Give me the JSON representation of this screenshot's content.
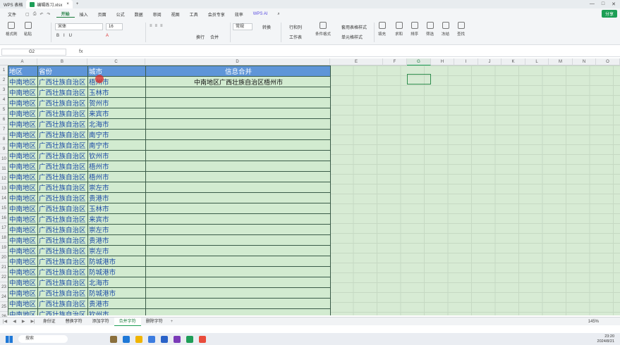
{
  "window": {
    "app_tab": "WPS 表格",
    "doc_tab": "编辑练习.xlsx"
  },
  "menu": {
    "file": "文件",
    "items": [
      "开始",
      "插入",
      "页面",
      "公式",
      "数据",
      "审阅",
      "视图",
      "工具",
      "会员专享",
      "效率"
    ],
    "ai": "WPS AI",
    "share": "分享"
  },
  "ribbon": {
    "format_painter": "格式刷",
    "paste": "粘贴",
    "font_name": "宋体",
    "font_size": "16",
    "wrap": "换行",
    "merge": "合并",
    "number_format": "常规",
    "convert": "转换",
    "row_col": "行和列",
    "worksheet": "工作表",
    "cond_format": "条件格式",
    "table_style": "套用表格样式",
    "cell_style": "单元格样式",
    "fill": "填充",
    "sum": "求和",
    "sort": "排序",
    "filter": "筛选",
    "freeze": "冻结",
    "find": "查找"
  },
  "formula_bar": {
    "cell_ref": "G2",
    "fx": "fx"
  },
  "columns": [
    "A",
    "B",
    "C",
    "D",
    "E",
    "F",
    "G",
    "H",
    "I",
    "J",
    "K",
    "L",
    "M",
    "N",
    "O"
  ],
  "sheet": {
    "headers": [
      "地区",
      "省份",
      "城市",
      "信息合并"
    ],
    "merged_value": "中南地区广西壮族自治区梧州市",
    "rows": [
      [
        "中南地区",
        "广西壮族自治区",
        "梧州市"
      ],
      [
        "中南地区",
        "广西壮族自治区",
        "玉林市"
      ],
      [
        "中南地区",
        "广西壮族自治区",
        "贺州市"
      ],
      [
        "中南地区",
        "广西壮族自治区",
        "来宾市"
      ],
      [
        "中南地区",
        "广西壮族自治区",
        "北海市"
      ],
      [
        "中南地区",
        "广西壮族自治区",
        "南宁市"
      ],
      [
        "中南地区",
        "广西壮族自治区",
        "南宁市"
      ],
      [
        "中南地区",
        "广西壮族自治区",
        "钦州市"
      ],
      [
        "中南地区",
        "广西壮族自治区",
        "梧州市"
      ],
      [
        "中南地区",
        "广西壮族自治区",
        "梧州市"
      ],
      [
        "中南地区",
        "广西壮族自治区",
        "崇左市"
      ],
      [
        "中南地区",
        "广西壮族自治区",
        "贵港市"
      ],
      [
        "中南地区",
        "广西壮族自治区",
        "玉林市"
      ],
      [
        "中南地区",
        "广西壮族自治区",
        "来宾市"
      ],
      [
        "中南地区",
        "广西壮族自治区",
        "崇左市"
      ],
      [
        "中南地区",
        "广西壮族自治区",
        "贵港市"
      ],
      [
        "中南地区",
        "广西壮族自治区",
        "崇左市"
      ],
      [
        "中南地区",
        "广西壮族自治区",
        "防城港市"
      ],
      [
        "中南地区",
        "广西壮族自治区",
        "防城港市"
      ],
      [
        "中南地区",
        "广西壮族自治区",
        "北海市"
      ],
      [
        "中南地区",
        "广西壮族自治区",
        "防城港市"
      ],
      [
        "中南地区",
        "广西壮族自治区",
        "贵港市"
      ],
      [
        "中南地区",
        "广西壮族自治区",
        "钦州市"
      ],
      [
        "中南地区",
        "广西壮族自治区",
        "崇左市"
      ],
      [
        "中南地区",
        "广西壮族自治区",
        "贺州市"
      ]
    ]
  },
  "sheet_tabs": [
    "身份证",
    "替换字符",
    "添加字符",
    "合并字符",
    "删除字符"
  ],
  "active_sheet_tab": "合并字符",
  "zoom": "145%",
  "taskbar": {
    "search": "搜索",
    "time": "23:20",
    "date": "2024/8/21"
  }
}
